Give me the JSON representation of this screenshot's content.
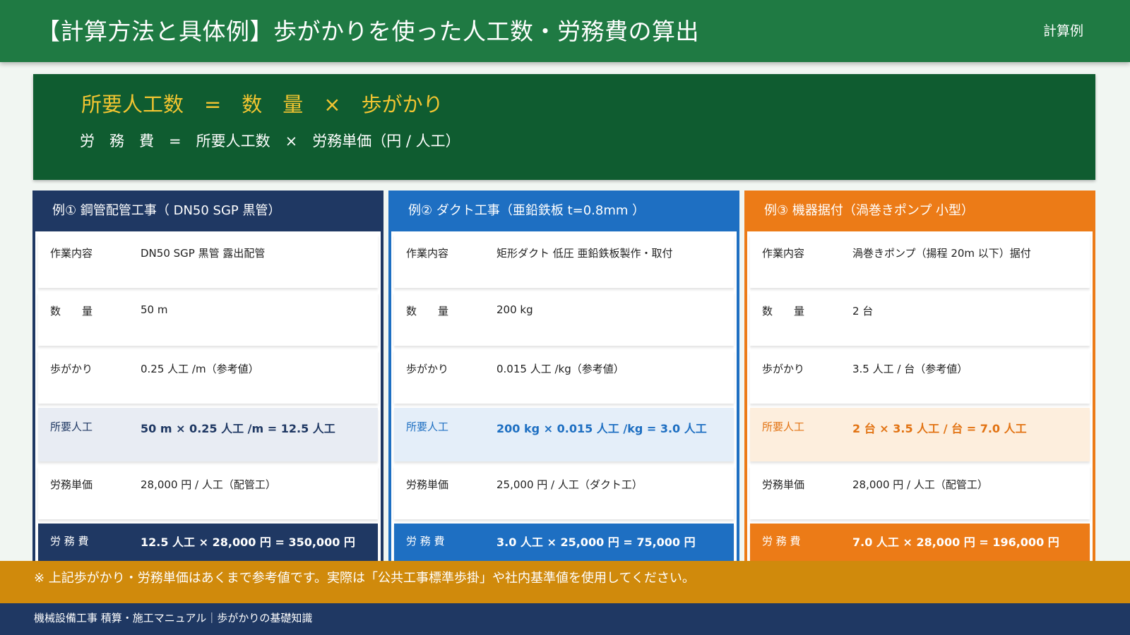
{
  "header": {
    "title": "【計算方法と具体例】歩がかりを使った人工数・労務費の算出",
    "tag": "計算例"
  },
  "formula": {
    "line1": "所要人工数　=　数　量　×　歩がかり",
    "line2": "労　務　費　=　所要人工数　×　労務単価（円 / 人工）"
  },
  "cards": [
    {
      "title": "例① 鋼管配管工事（ DN50 SGP 黒管）",
      "rows": [
        {
          "label": "作業内容",
          "value": "DN50 SGP 黒管 露出配管"
        },
        {
          "label": "数　　量",
          "value": "50 m"
        },
        {
          "label": "歩がかり",
          "value": "0.25 人工 /m（参考値）"
        },
        {
          "label": "所要人工",
          "value": "50 m × 0.25 人工 /m = 12.5 人工"
        },
        {
          "label": "労務単価",
          "value": "28,000 円 / 人工（配管工）"
        },
        {
          "label": "労 務 費",
          "value": "12.5 人工 × 28,000 円 = 350,000 円"
        }
      ]
    },
    {
      "title": "例② ダクト工事（亜鉛鉄板 t=0.8mm ）",
      "rows": [
        {
          "label": "作業内容",
          "value": "矩形ダクト 低圧 亜鉛鉄板製作・取付"
        },
        {
          "label": "数　　量",
          "value": "200 kg"
        },
        {
          "label": "歩がかり",
          "value": "0.015 人工 /kg（参考値）"
        },
        {
          "label": "所要人工",
          "value": "200 kg × 0.015 人工 /kg = 3.0 人工"
        },
        {
          "label": "労務単価",
          "value": "25,000 円 / 人工（ダクト工）"
        },
        {
          "label": "労 務 費",
          "value": "3.0 人工 × 25,000 円 = 75,000 円"
        }
      ]
    },
    {
      "title": "例③ 機器据付（渦巻きポンプ 小型）",
      "rows": [
        {
          "label": "作業内容",
          "value": "渦巻きポンプ（揚程 20m 以下）据付"
        },
        {
          "label": "数　　量",
          "value": "2 台"
        },
        {
          "label": "歩がかり",
          "value": "3.5 人工 / 台（参考値）"
        },
        {
          "label": "所要人工",
          "value": "2 台 × 3.5 人工 / 台 = 7.0 人工"
        },
        {
          "label": "労務単価",
          "value": "28,000 円 / 人工（配管工）"
        },
        {
          "label": "労 務 費",
          "value": "7.0 人工 × 28,000 円 = 196,000 円"
        }
      ]
    }
  ],
  "note": "※ 上記歩がかり・労務単価はあくまで参考値です。実際は「公共工事標準歩掛」や社内基準値を使用してください。",
  "footer": "機械設備工事 積算・施工マニュアル｜歩がかりの基礎知識",
  "colors": {
    "header": "#1f7a43",
    "formula_bg": "#0f5c30",
    "formula_accent": "#f2c531",
    "card1": "#1f3863",
    "card2": "#1e6fc2",
    "card3": "#ec7b17",
    "note": "#d08a0c",
    "footer": "#1f3863"
  }
}
